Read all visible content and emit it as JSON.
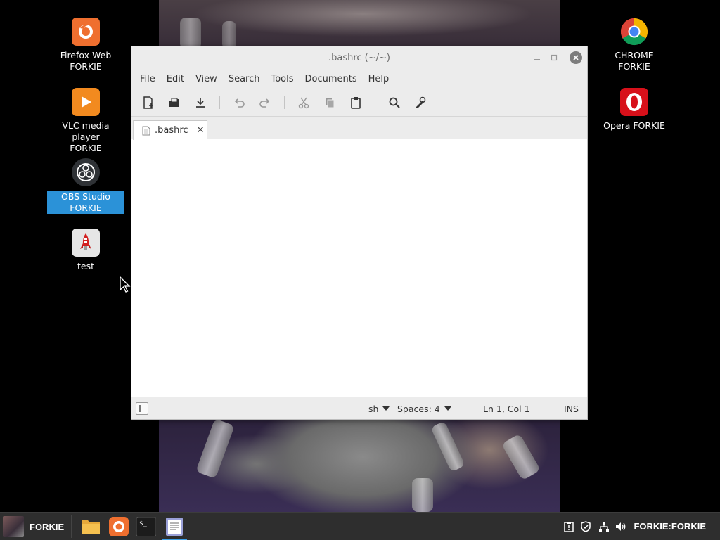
{
  "desktop": {
    "icons_left": [
      {
        "label_line1": "Firefox Web",
        "label_line2": "FORKIE",
        "icon": "firefox-icon"
      },
      {
        "label_line1": "VLC media player",
        "label_line2": "FORKIE",
        "icon": "vlc-icon"
      },
      {
        "label_line1": "OBS Studio",
        "label_line2": "FORKIE",
        "icon": "obs-icon",
        "selected": true
      },
      {
        "label_line1": "test",
        "label_line2": "",
        "icon": "rocket-icon"
      }
    ],
    "icons_right": [
      {
        "label_line1": "CHROME FORKIE",
        "icon": "chrome-icon"
      },
      {
        "label_line1": "Opera FORKIE",
        "icon": "opera-icon"
      }
    ]
  },
  "window": {
    "title": ".bashrc (~/~)",
    "menu": [
      "File",
      "Edit",
      "View",
      "Search",
      "Tools",
      "Documents",
      "Help"
    ],
    "toolbar": [
      "new-document-icon",
      "open-icon",
      "save-icon",
      "undo-icon",
      "redo-icon",
      "cut-icon",
      "copy-icon",
      "paste-icon",
      "find-icon",
      "find-replace-icon"
    ],
    "tab": {
      "label": ".bashrc",
      "close": "✕"
    },
    "editor_content": "",
    "status": {
      "language": "sh",
      "indent": "Spaces: 4",
      "position": "Ln 1, Col 1",
      "mode": "INS"
    }
  },
  "taskbar": {
    "start_label": "FORKIE",
    "apps": [
      "folder-icon",
      "firefox-icon",
      "terminal-icon",
      "text-editor-icon"
    ],
    "active_app": "text-editor-icon",
    "tray": [
      "clipboard-icon",
      "shield-icon",
      "network-icon",
      "volume-icon"
    ],
    "user": "FORKIE:FORKIE"
  },
  "colors": {
    "selection": "#2b92d8",
    "taskbar": "#2e2e2e",
    "window_chrome": "#ececec",
    "firefox_orange": "#ef6f2f",
    "opera_red": "#d7101a"
  }
}
